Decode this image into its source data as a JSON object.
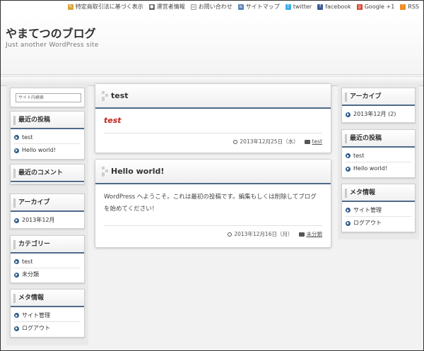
{
  "topbar": {
    "links": [
      {
        "label": "特定商取引法に基づく表示",
        "icon": "document-icon",
        "color": "#d8a53a"
      },
      {
        "label": "運営者情報",
        "icon": "person-icon",
        "color": "#6a6a6a"
      },
      {
        "label": "お問い合わせ",
        "icon": "mail-icon",
        "color": "#9a9a9a"
      },
      {
        "label": "サイトマップ",
        "icon": "sitemap-icon",
        "color": "#5a84b8"
      },
      {
        "label": "twitter",
        "icon": "twitter-icon",
        "color": "#3aaee8"
      },
      {
        "label": "facebook",
        "icon": "facebook-icon",
        "color": "#3b5998"
      },
      {
        "label": "Google +1",
        "icon": "google-plus-icon",
        "color": "#d8432f"
      },
      {
        "label": "RSS",
        "icon": "rss-icon",
        "color": "#f08c1e"
      }
    ]
  },
  "header": {
    "title": "やまてつのブログ",
    "tagline": "Just another WordPress site"
  },
  "left_sidebar": {
    "search_placeholder": "サイト内検索",
    "recent_posts": {
      "title": "最近の投稿",
      "items": [
        "test",
        "Hello world!"
      ]
    },
    "recent_comments": {
      "title": "最近のコメント"
    },
    "archives": {
      "title": "アーカイブ",
      "items": [
        "2013年12月"
      ]
    },
    "categories": {
      "title": "カテゴリー",
      "items": [
        "test",
        "未分類"
      ]
    },
    "meta": {
      "title": "メタ情報",
      "items": [
        "サイト管理",
        "ログアウト"
      ]
    }
  },
  "posts": [
    {
      "title": "test",
      "body": "test",
      "date": "2013年12月25日（水）",
      "category": "test"
    },
    {
      "title": "Hello world!",
      "body": "WordPress へようこそ。これは最初の投稿です。編集もしくは削除してブログを始めてください！",
      "date": "2013年12月16日（月）",
      "category": "未分類"
    }
  ],
  "right_sidebar": {
    "archives": {
      "title": "アーカイブ",
      "items": [
        "2013年12月 (2)"
      ]
    },
    "recent_posts": {
      "title": "最近の投稿",
      "items": [
        "test",
        "Hello world!"
      ]
    },
    "meta": {
      "title": "メタ情報",
      "items": [
        "サイト管理",
        "ログアウト"
      ]
    }
  },
  "colors": {
    "accent": "#4f6a8a",
    "bullet": "#2f5b8c",
    "post_red": "#c0261d"
  }
}
